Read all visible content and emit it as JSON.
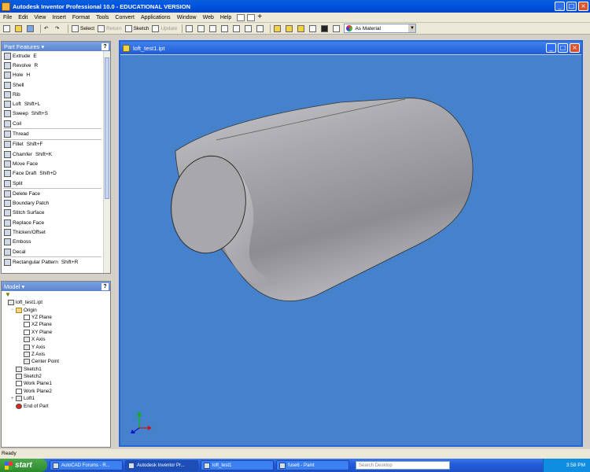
{
  "app": {
    "title": "Autodesk Inventor Professional 10.0 - EDUCATIONAL VERSION"
  },
  "menu": [
    "File",
    "Edit",
    "View",
    "Insert",
    "Format",
    "Tools",
    "Convert",
    "Applications",
    "Window",
    "Web",
    "Help"
  ],
  "toolbar": {
    "select": "Select",
    "return": "Return",
    "sketch": "Sketch",
    "update": "Update",
    "material": "As Material"
  },
  "part_features": {
    "title": "Part Features",
    "help": "?",
    "groups": [
      [
        {
          "label": "Extrude",
          "shortcut": "E"
        },
        {
          "label": "Revolve",
          "shortcut": "R"
        },
        {
          "label": "Hole",
          "shortcut": "H"
        },
        {
          "label": "Shell",
          "shortcut": ""
        },
        {
          "label": "Rib",
          "shortcut": ""
        },
        {
          "label": "Loft",
          "shortcut": "Shift+L"
        },
        {
          "label": "Sweep",
          "shortcut": "Shift+S"
        },
        {
          "label": "Coil",
          "shortcut": ""
        }
      ],
      [
        {
          "label": "Thread",
          "shortcut": ""
        }
      ],
      [
        {
          "label": "Fillet",
          "shortcut": "Shift+F"
        },
        {
          "label": "Chamfer",
          "shortcut": "Shift+K"
        },
        {
          "label": "Move Face",
          "shortcut": ""
        },
        {
          "label": "Face Draft",
          "shortcut": "Shift+D"
        },
        {
          "label": "Split",
          "shortcut": ""
        }
      ],
      [
        {
          "label": "Delete Face",
          "shortcut": ""
        },
        {
          "label": "Boundary Patch",
          "shortcut": ""
        },
        {
          "label": "Stitch Surface",
          "shortcut": ""
        },
        {
          "label": "Replace Face",
          "shortcut": ""
        },
        {
          "label": "Thicken/Offset",
          "shortcut": ""
        },
        {
          "label": "Emboss",
          "shortcut": ""
        },
        {
          "label": "Decal",
          "shortcut": ""
        }
      ],
      [
        {
          "label": "Rectangular Pattern",
          "shortcut": "Shift+R"
        }
      ]
    ]
  },
  "model": {
    "title": "Model",
    "help": "?",
    "filter_icon": "funnel-icon",
    "tree": [
      {
        "label": "loft_test1.ipt",
        "depth": 0,
        "icon": "part-icon",
        "toggle": ""
      },
      {
        "label": "Origin",
        "depth": 1,
        "icon": "folder-icon",
        "toggle": "−"
      },
      {
        "label": "YZ Plane",
        "depth": 2,
        "icon": "plane-icon",
        "toggle": ""
      },
      {
        "label": "XZ Plane",
        "depth": 2,
        "icon": "plane-icon",
        "toggle": ""
      },
      {
        "label": "XY Plane",
        "depth": 2,
        "icon": "plane-icon",
        "toggle": ""
      },
      {
        "label": "X Axis",
        "depth": 2,
        "icon": "axis-icon",
        "toggle": ""
      },
      {
        "label": "Y Axis",
        "depth": 2,
        "icon": "axis-icon",
        "toggle": ""
      },
      {
        "label": "Z Axis",
        "depth": 2,
        "icon": "axis-icon",
        "toggle": ""
      },
      {
        "label": "Center Point",
        "depth": 2,
        "icon": "point-icon",
        "toggle": ""
      },
      {
        "label": "Sketch1",
        "depth": 1,
        "icon": "sketch-icon",
        "toggle": ""
      },
      {
        "label": "Sketch2",
        "depth": 1,
        "icon": "sketch-icon",
        "toggle": ""
      },
      {
        "label": "Work Plane1",
        "depth": 1,
        "icon": "plane-icon",
        "toggle": ""
      },
      {
        "label": "Work Plane2",
        "depth": 1,
        "icon": "plane-icon",
        "toggle": ""
      },
      {
        "label": "Loft1",
        "depth": 1,
        "icon": "loft-icon",
        "toggle": "+"
      },
      {
        "label": "End of Part",
        "depth": 1,
        "icon": "end-icon",
        "toggle": ""
      }
    ]
  },
  "document": {
    "title": "loft_test1.ipt"
  },
  "status": {
    "text": "Ready"
  },
  "taskbar": {
    "start": "start",
    "tasks": [
      "AutoCAD Forums - R...",
      "Autodesk Inventor Pr...",
      "loft_test1",
      "fuse6 - Paint"
    ],
    "active_index": 1,
    "search_placeholder": "Search Desktop",
    "clock": "3:58 PM"
  },
  "colors": {
    "viewport": "#4682cc",
    "title_bar": "#0054e3",
    "model_shade": "#a7a7ab"
  }
}
